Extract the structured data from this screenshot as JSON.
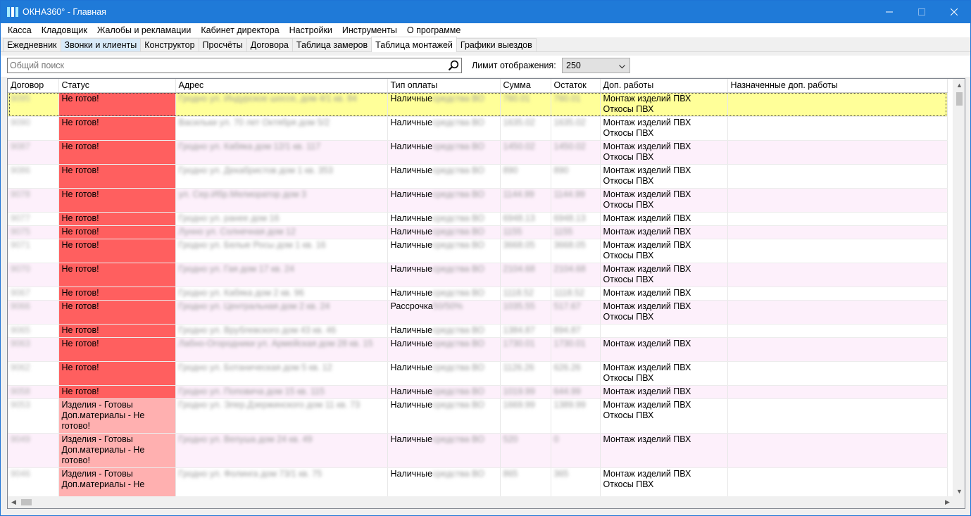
{
  "window": {
    "title": "ОКНА360° - Главная"
  },
  "menu": [
    "Касса",
    "Кладовщик",
    "Жалобы и рекламации",
    "Кабинет директора",
    "Настройки",
    "Инструменты",
    "О программе"
  ],
  "tabs": [
    {
      "label": "Ежедневник",
      "state": ""
    },
    {
      "label": "Звонки и клиенты",
      "state": "hover"
    },
    {
      "label": "Конструктор",
      "state": ""
    },
    {
      "label": "Просчёты",
      "state": ""
    },
    {
      "label": "Договора",
      "state": ""
    },
    {
      "label": "Таблица замеров",
      "state": ""
    },
    {
      "label": "Таблица монтажей",
      "state": "active"
    },
    {
      "label": "Графики выездов",
      "state": ""
    }
  ],
  "toolbar": {
    "search_placeholder": "Общий поиск",
    "limit_label": "Лимит отображения:",
    "limit_value": "250"
  },
  "table": {
    "columns": [
      "Договор",
      "Статус",
      "Адрес",
      "Тип оплаты",
      "Сумма",
      "Остаток",
      "Доп. работы",
      "Назначенные доп. работы"
    ],
    "rows": [
      {
        "contract": "9095",
        "status": "Не готов!",
        "status_color": "red",
        "address": "Гродно ул. Индурское шоссе, дом 4/1 кв. 84",
        "payment": "Наличные",
        "payment_detail": "средства ВО",
        "sum": "760.01",
        "rest": "760.01",
        "extra": [
          "Монтаж изделий ПВХ",
          "Откосы ПВХ"
        ],
        "assigned": "",
        "selected": true
      },
      {
        "contract": "9090",
        "status": "Не готов!",
        "status_color": "red",
        "address": "Васильки ул. 70 лет Октября дом 5/2",
        "payment": "Наличные",
        "payment_detail": "средства ВО",
        "sum": "1635.02",
        "rest": "1635.02",
        "extra": [
          "Монтаж изделий ПВХ",
          "Откосы ПВХ"
        ],
        "assigned": ""
      },
      {
        "contract": "9087",
        "status": "Не готов!",
        "status_color": "red",
        "address": "Гродно ул. Кабяка дом 12/1 кв. 117",
        "payment": "Наличные",
        "payment_detail": "средства ВО",
        "sum": "1450.02",
        "rest": "1450.02",
        "extra": [
          "Монтаж изделий ПВХ",
          "Откосы ПВХ"
        ],
        "assigned": ""
      },
      {
        "contract": "9086",
        "status": "Не готов!",
        "status_color": "red",
        "address": "Гродно ул. Декабристов дом 1 кв. 353",
        "payment": "Наличные",
        "payment_detail": "средства ВО",
        "sum": "890",
        "rest": "890",
        "extra": [
          "Монтаж изделий ПВХ",
          "Откосы ПВХ"
        ],
        "assigned": ""
      },
      {
        "contract": "9078",
        "status": "Не готов!",
        "status_color": "red",
        "address": "ул. Сер.Ибр.Мелиоратор дом 3",
        "payment": "Наличные",
        "payment_detail": "средства ВО",
        "sum": "1144.99",
        "rest": "1144.99",
        "extra": [
          "Монтаж изделий ПВХ",
          "Откосы ПВХ"
        ],
        "assigned": ""
      },
      {
        "contract": "9077",
        "status": "Не готов!",
        "status_color": "red",
        "address": "Гродно ул. ранее дом 16",
        "payment": "Наличные",
        "payment_detail": "средства ВО",
        "sum": "6948.13",
        "rest": "6948.13",
        "extra": [
          "Монтаж изделий ПВХ"
        ],
        "assigned": ""
      },
      {
        "contract": "9075",
        "status": "Не готов!",
        "status_color": "red",
        "address": "Лунно ул. Солнечная дом 12",
        "payment": "Наличные",
        "payment_detail": "средства ВО",
        "sum": "1155",
        "rest": "1155",
        "extra": [
          "Монтаж изделий ПВХ"
        ],
        "assigned": ""
      },
      {
        "contract": "9071",
        "status": "Не готов!",
        "status_color": "red",
        "address": "Гродно ул. Белые Росы дом 1 кв. 16",
        "payment": "Наличные",
        "payment_detail": "средства ВО",
        "sum": "3668.05",
        "rest": "3668.05",
        "extra": [
          "Монтаж изделий ПВХ",
          "Откосы ПВХ"
        ],
        "assigned": ""
      },
      {
        "contract": "9070",
        "status": "Не готов!",
        "status_color": "red",
        "address": "Гродно ул. Гая дом 17 кв. 24",
        "payment": "Наличные",
        "payment_detail": "средства ВО",
        "sum": "2104.68",
        "rest": "2104.68",
        "extra": [
          "Монтаж изделий ПВХ",
          "Откосы ПВХ"
        ],
        "assigned": ""
      },
      {
        "contract": "9067",
        "status": "Не готов!",
        "status_color": "red",
        "address": "Гродно ул. Кабяка дом 2 кв. 96",
        "payment": "Наличные",
        "payment_detail": "средства ВО",
        "sum": "1118.52",
        "rest": "1118.52",
        "extra": [
          "Монтаж изделий ПВХ"
        ],
        "assigned": ""
      },
      {
        "contract": "9066",
        "status": "Не готов!",
        "status_color": "red",
        "address": "Гродно ул. Центральная дом 2 кв. 24",
        "payment": "Рассрочка",
        "payment_detail": "50/50%",
        "sum": "1035.55",
        "rest": "517.67",
        "extra": [
          "Монтаж изделий ПВХ",
          "Откосы ПВХ"
        ],
        "assigned": ""
      },
      {
        "contract": "9065",
        "status": "Не готов!",
        "status_color": "red",
        "address": "Гродно ул. Врублевского дом 43 кв. 46",
        "payment": "Наличные",
        "payment_detail": "средства ВО",
        "sum": "1384.87",
        "rest": "894.87",
        "extra": [],
        "assigned": ""
      },
      {
        "contract": "9063",
        "status": "Не готов!",
        "status_color": "red",
        "address": "Лабно-Огородники ул. Армейская дом 28 кв. 15",
        "payment": "Наличные",
        "payment_detail": "средства ВО",
        "sum": "1730.01",
        "rest": "1730.01",
        "extra": [
          "Монтаж изделий ПВХ"
        ],
        "assigned": ""
      },
      {
        "contract": "9062",
        "status": "Не готов!",
        "status_color": "red",
        "address": "Гродно ул. Ботаническая дом 5 кв. 12",
        "payment": "Наличные",
        "payment_detail": "средства ВО",
        "sum": "1126.26",
        "rest": "626.26",
        "extra": [
          "Монтаж изделий ПВХ",
          "Откосы ПВХ"
        ],
        "assigned": ""
      },
      {
        "contract": "9058",
        "status": "Не готов!",
        "status_color": "red",
        "address": "Гродно ул. Поповича дом 15 кв. 115",
        "payment": "Наличные",
        "payment_detail": "средства ВО",
        "sum": "1019.99",
        "rest": "644.99",
        "extra": [
          "Монтаж изделий ПВХ"
        ],
        "assigned": ""
      },
      {
        "contract": "9053",
        "status": "Изделия - Готовы\nДоп.материалы - Не готово!",
        "status_color": "pink",
        "address": "Гродно ул. Элер.Дзержинского дом 11 кв. 73",
        "payment": "Наличные",
        "payment_detail": "средства ВО",
        "sum": "1669.99",
        "rest": "1389.99",
        "extra": [
          "Монтаж изделий ПВХ",
          "Откосы ПВХ"
        ],
        "assigned": ""
      },
      {
        "contract": "9049",
        "status": "Изделия - Готовы\nДоп.материалы - Не готово!",
        "status_color": "pink",
        "address": "Гродно ул. Вепуша дом 24 кв. 49",
        "payment": "Наличные",
        "payment_detail": "средства ВО",
        "sum": "520",
        "rest": "0",
        "extra": [
          "Монтаж изделий ПВХ"
        ],
        "assigned": ""
      },
      {
        "contract": "9046",
        "status": "Изделия - Готовы\nДоп.материалы - Не",
        "status_color": "pink",
        "address": "Гродно ул. Фолинга дом 73/1 кв. 75",
        "payment": "Наличные",
        "payment_detail": "средства ВО",
        "sum": "865",
        "rest": "365",
        "extra": [
          "Монтаж изделий ПВХ",
          "Откосы ПВХ"
        ],
        "assigned": ""
      }
    ]
  }
}
